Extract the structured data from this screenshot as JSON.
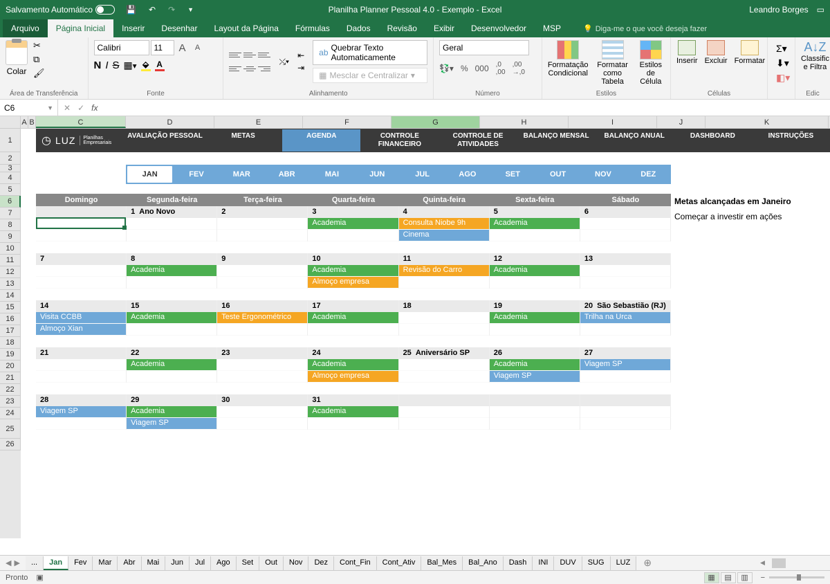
{
  "titleBar": {
    "autoSave": "Salvamento Automático",
    "title": "Planilha Planner Pessoal 4.0 - Exemplo  -  Excel",
    "user": "Leandro Borges"
  },
  "menuTabs": [
    "Arquivo",
    "Página Inicial",
    "Inserir",
    "Desenhar",
    "Layout da Página",
    "Fórmulas",
    "Dados",
    "Revisão",
    "Exibir",
    "Desenvolvedor",
    "MSP"
  ],
  "tellMe": "Diga-me o que você deseja fazer",
  "ribbon": {
    "clipboard": {
      "paste": "Colar",
      "label": "Área de Transferência"
    },
    "font": {
      "name": "Calibri",
      "size": "11",
      "label": "Fonte"
    },
    "alignment": {
      "wrap": "Quebrar Texto Automaticamente",
      "merge": "Mesclar e Centralizar",
      "label": "Alinhamento"
    },
    "number": {
      "format": "Geral",
      "label": "Número"
    },
    "styles": {
      "cond": "Formatação Condicional",
      "table": "Formatar como Tabela",
      "cell": "Estilos de Célula",
      "label": "Estilos"
    },
    "cells": {
      "insert": "Inserir",
      "delete": "Excluir",
      "format": "Formatar",
      "label": "Células"
    },
    "editing": {
      "sort": "Classific e Filtra",
      "label": "Edic"
    }
  },
  "nameBox": "C6",
  "columns": [
    "A",
    "B",
    "C",
    "D",
    "E",
    "F",
    "G",
    "H",
    "I",
    "J",
    "K"
  ],
  "plannerNav": {
    "logo": "LUZ",
    "logoSub": "Planilhas Empresariais",
    "items": [
      "AVALIAÇÃO PESSOAL",
      "METAS",
      "AGENDA",
      "CONTROLE FINANCEIRO",
      "CONTROLE DE ATIVIDADES",
      "BALANÇO MENSAL",
      "BALANÇO ANUAL",
      "DASHBOARD",
      "INSTRUÇÕES"
    ],
    "activeIndex": 2
  },
  "months": [
    "JAN",
    "FEV",
    "MAR",
    "ABR",
    "MAI",
    "JUN",
    "JUL",
    "AGO",
    "SET",
    "OUT",
    "NOV",
    "DEZ"
  ],
  "activeMonth": 0,
  "calendar": {
    "dayHeaders": [
      "Domingo",
      "Segunda-feira",
      "Terça-feira",
      "Quarta-feira",
      "Quinta-feira",
      "Sexta-feira",
      "Sábado"
    ],
    "weeks": [
      {
        "days": [
          {
            "num": "",
            "label": "",
            "events": [
              "",
              ""
            ]
          },
          {
            "num": "1",
            "label": "Ano Novo",
            "events": [
              "",
              ""
            ]
          },
          {
            "num": "2",
            "label": "",
            "events": [
              "",
              ""
            ]
          },
          {
            "num": "3",
            "label": "",
            "events": [
              {
                "t": "Academia",
                "c": "green"
              },
              ""
            ]
          },
          {
            "num": "4",
            "label": "",
            "events": [
              {
                "t": "Consulta Niobe 9h",
                "c": "orange"
              },
              {
                "t": "Cinema",
                "c": "blue"
              }
            ]
          },
          {
            "num": "5",
            "label": "",
            "events": [
              {
                "t": "Academia",
                "c": "green"
              },
              ""
            ]
          },
          {
            "num": "6",
            "label": "",
            "events": [
              "",
              ""
            ]
          }
        ]
      },
      {
        "days": [
          {
            "num": "7",
            "label": "",
            "events": [
              "",
              ""
            ]
          },
          {
            "num": "8",
            "label": "",
            "events": [
              {
                "t": "Academia",
                "c": "green"
              },
              ""
            ]
          },
          {
            "num": "9",
            "label": "",
            "events": [
              "",
              ""
            ]
          },
          {
            "num": "10",
            "label": "",
            "events": [
              {
                "t": "Academia",
                "c": "green"
              },
              {
                "t": "Almoço empresa",
                "c": "orange"
              }
            ]
          },
          {
            "num": "11",
            "label": "",
            "events": [
              {
                "t": "Revisão do Carro",
                "c": "orange"
              },
              ""
            ]
          },
          {
            "num": "12",
            "label": "",
            "events": [
              {
                "t": "Academia",
                "c": "green"
              },
              ""
            ]
          },
          {
            "num": "13",
            "label": "",
            "events": [
              "",
              ""
            ]
          }
        ]
      },
      {
        "days": [
          {
            "num": "14",
            "label": "",
            "events": [
              {
                "t": "Visita CCBB",
                "c": "blue"
              },
              {
                "t": "Almoço Xian",
                "c": "blue"
              }
            ]
          },
          {
            "num": "15",
            "label": "",
            "events": [
              {
                "t": "Academia",
                "c": "green"
              },
              ""
            ]
          },
          {
            "num": "16",
            "label": "",
            "events": [
              {
                "t": "Teste Ergonométrico",
                "c": "orange"
              },
              ""
            ]
          },
          {
            "num": "17",
            "label": "",
            "events": [
              {
                "t": "Academia",
                "c": "green"
              },
              ""
            ]
          },
          {
            "num": "18",
            "label": "",
            "events": [
              "",
              ""
            ]
          },
          {
            "num": "19",
            "label": "",
            "events": [
              {
                "t": "Academia",
                "c": "green"
              },
              ""
            ]
          },
          {
            "num": "20",
            "label": "São Sebastião (RJ)",
            "events": [
              {
                "t": "Trilha na Urca",
                "c": "blue"
              },
              ""
            ]
          }
        ]
      },
      {
        "days": [
          {
            "num": "21",
            "label": "",
            "events": [
              "",
              ""
            ]
          },
          {
            "num": "22",
            "label": "",
            "events": [
              {
                "t": "Academia",
                "c": "green"
              },
              ""
            ]
          },
          {
            "num": "23",
            "label": "",
            "events": [
              "",
              ""
            ]
          },
          {
            "num": "24",
            "label": "",
            "events": [
              {
                "t": "Academia",
                "c": "green"
              },
              {
                "t": "Almoço empresa",
                "c": "orange"
              }
            ]
          },
          {
            "num": "25",
            "label": "Aniversário SP",
            "events": [
              "",
              ""
            ]
          },
          {
            "num": "26",
            "label": "",
            "events": [
              {
                "t": "Academia",
                "c": "green"
              },
              {
                "t": "Viagem SP",
                "c": "blue"
              }
            ]
          },
          {
            "num": "27",
            "label": "",
            "events": [
              {
                "t": "Viagem SP",
                "c": "blue"
              },
              ""
            ]
          }
        ]
      },
      {
        "days": [
          {
            "num": "28",
            "label": "",
            "events": [
              {
                "t": "Viagem SP",
                "c": "blue"
              },
              ""
            ]
          },
          {
            "num": "29",
            "label": "",
            "events": [
              {
                "t": "Academia",
                "c": "green"
              },
              {
                "t": "Viagem SP",
                "c": "blue"
              }
            ]
          },
          {
            "num": "30",
            "label": "",
            "events": [
              "",
              ""
            ]
          },
          {
            "num": "31",
            "label": "",
            "events": [
              {
                "t": "Academia",
                "c": "green"
              },
              ""
            ]
          },
          {
            "num": "",
            "label": "",
            "events": [
              "",
              ""
            ]
          },
          {
            "num": "",
            "label": "",
            "events": [
              "",
              ""
            ]
          },
          {
            "num": "",
            "label": "",
            "events": [
              "",
              ""
            ]
          }
        ]
      }
    ]
  },
  "goals": {
    "title": "Metas alcançadas em Janeiro",
    "items": [
      "Começar a investir em ações"
    ]
  },
  "sheetTabs": [
    "...",
    "Jan",
    "Fev",
    "Mar",
    "Abr",
    "Mai",
    "Jun",
    "Jul",
    "Ago",
    "Set",
    "Out",
    "Nov",
    "Dez",
    "Cont_Fin",
    "Cont_Ativ",
    "Bal_Mes",
    "Bal_Ano",
    "Dash",
    "INI",
    "DUV",
    "SUG",
    "LUZ"
  ],
  "activeSheetTab": 1,
  "statusBar": {
    "ready": "Pronto"
  },
  "rowHeights": {
    "calendar": [
      18,
      34,
      17,
      17,
      17,
      17,
      17,
      17,
      17,
      17,
      17,
      17,
      17,
      17,
      17,
      17,
      17,
      17,
      17,
      17,
      17,
      17,
      17,
      28,
      17
    ]
  }
}
